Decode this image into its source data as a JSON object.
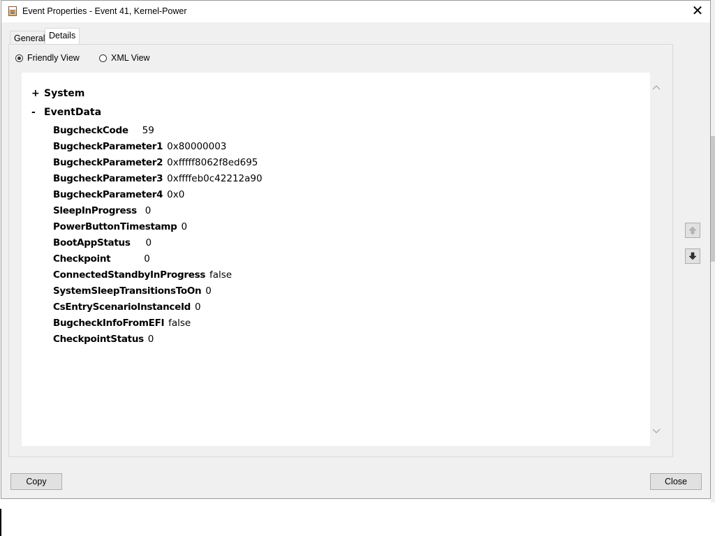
{
  "window": {
    "title": "Event Properties - Event 41, Kernel-Power",
    "close_glyph": "✕"
  },
  "tabs": [
    {
      "label": "General"
    },
    {
      "label": "Details"
    }
  ],
  "view_options": {
    "friendly_label": "Friendly View",
    "xml_label": "XML View",
    "selected": "Friendly View"
  },
  "tree": {
    "system": {
      "toggle": "+",
      "label": "System"
    },
    "eventdata": {
      "toggle": "-",
      "label": "EventData"
    },
    "fields": [
      {
        "name": "BugcheckCode",
        "value": "59"
      },
      {
        "name": "BugcheckParameter1",
        "value": "0x80000003"
      },
      {
        "name": "BugcheckParameter2",
        "value": "0xfffff8062f8ed695"
      },
      {
        "name": "BugcheckParameter3",
        "value": "0xffffeb0c42212a90"
      },
      {
        "name": "BugcheckParameter4",
        "value": "0x0"
      },
      {
        "name": "SleepInProgress",
        "value": "0"
      },
      {
        "name": "PowerButtonTimestamp",
        "value": "0"
      },
      {
        "name": "BootAppStatus",
        "value": "0"
      },
      {
        "name": "Checkpoint",
        "value": "0"
      },
      {
        "name": "ConnectedStandbyInProgress",
        "value": "false"
      },
      {
        "name": "SystemSleepTransitionsToOn",
        "value": "0"
      },
      {
        "name": "CsEntryScenarioInstanceId",
        "value": "0"
      },
      {
        "name": "BugcheckInfoFromEFI",
        "value": "false"
      },
      {
        "name": "CheckpointStatus",
        "value": "0"
      }
    ]
  },
  "side_buttons": {
    "up_glyph": "🡅",
    "down_glyph": "🡇"
  },
  "buttons": {
    "copy": "Copy",
    "close": "Close"
  }
}
